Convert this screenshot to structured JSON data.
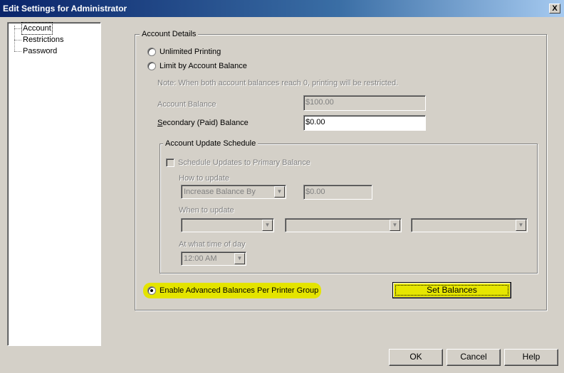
{
  "window": {
    "title": "Edit Settings for Administrator",
    "close_glyph": "X"
  },
  "tree": {
    "items": [
      {
        "label": "Account",
        "selected": true
      },
      {
        "label": "Restrictions",
        "selected": false
      },
      {
        "label": "Password",
        "selected": false
      }
    ]
  },
  "account_details": {
    "group_title": "Account Details",
    "unlimited_label": "Unlimited Printing",
    "limit_label": "Limit by Account Balance",
    "note": "Note: When both account balances reach 0, printing will be restricted.",
    "account_balance_label": "Account Balance",
    "account_balance_value": "$100.00",
    "secondary_label_prefix": "S",
    "secondary_label_rest": "econdary (Paid) Balance",
    "secondary_value": "$0.00"
  },
  "schedule": {
    "group_title": "Account Update Schedule",
    "schedule_checkbox_label": "Schedule Updates to Primary Balance",
    "how_label": "How to update",
    "how_value": "Increase Balance By",
    "amount_value": "$0.00",
    "when_label": "When to update",
    "time_label": "At what time of day",
    "time_value": "12:00 AM"
  },
  "advanced": {
    "enable_label": "Enable Advanced Balances Per Printer Group",
    "set_balances_label": "Set Balances",
    "highlight_color": "#e4e400"
  },
  "footer": {
    "ok_label": "OK",
    "cancel_label": "Cancel",
    "help_label": "Help"
  }
}
